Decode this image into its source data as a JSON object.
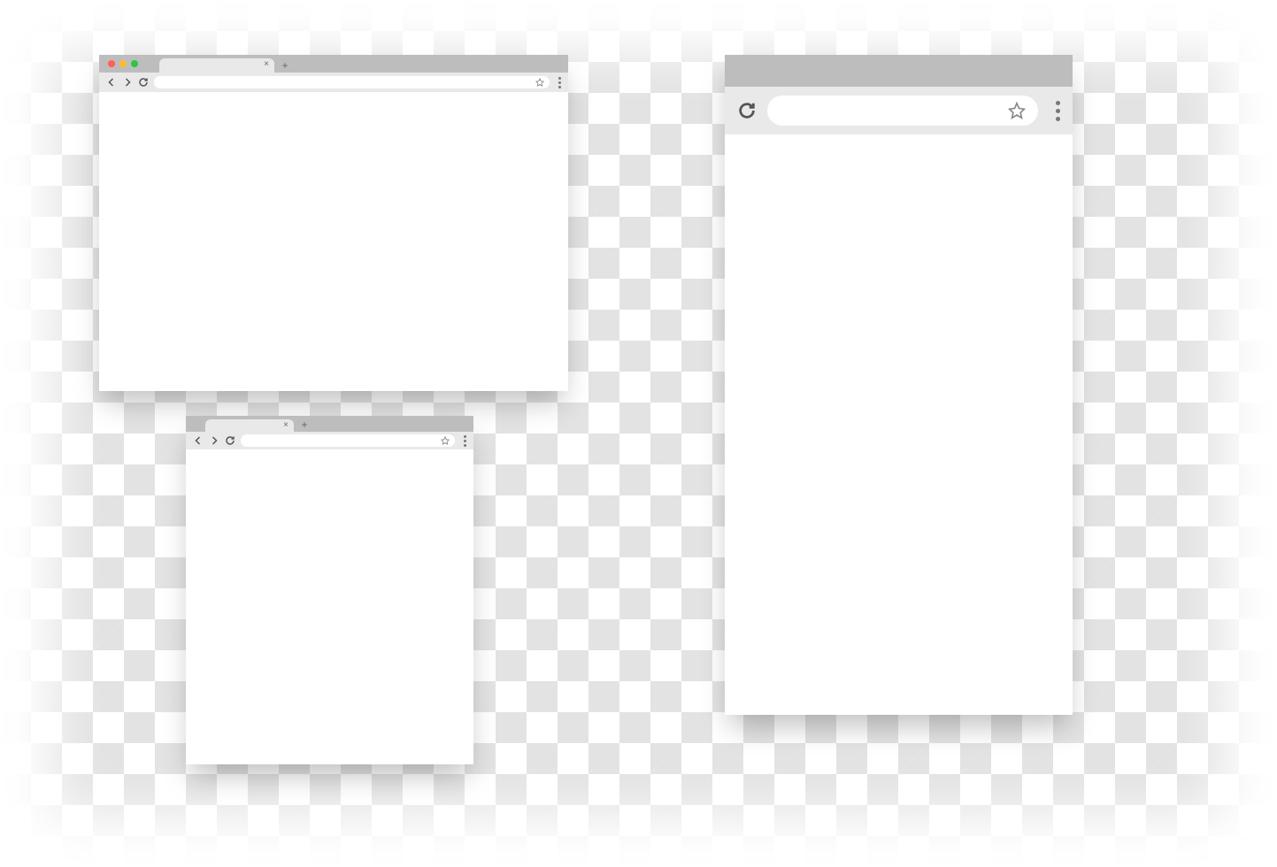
{
  "windows": {
    "desktop": {
      "traffic_lights": [
        "close",
        "minimize",
        "maximize"
      ],
      "tab_close": "×",
      "new_tab": "+",
      "address_value": "",
      "address_placeholder": ""
    },
    "tablet": {
      "tab_close": "×",
      "new_tab": "+",
      "address_value": "",
      "address_placeholder": ""
    },
    "mobile": {
      "address_value": "",
      "address_placeholder": ""
    }
  },
  "colors": {
    "tabbar": "#bdbdbd",
    "toolbar": "#e9e9e9",
    "content": "#ffffff",
    "checker_light": "#ffffff",
    "checker_dark": "#e3e3e3"
  }
}
